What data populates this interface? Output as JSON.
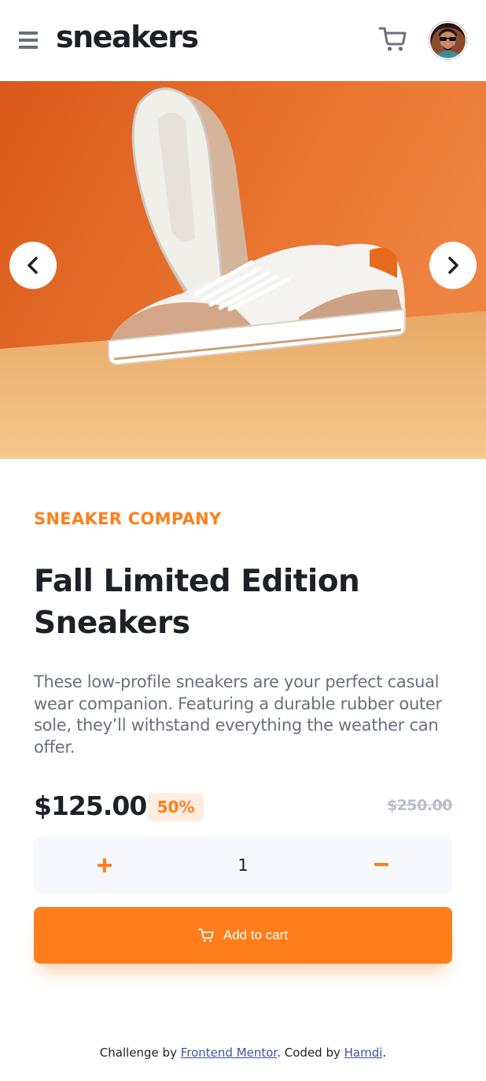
{
  "header": {
    "menu_icon": "hamburger-menu-icon",
    "logo": "sneakers",
    "cart_icon": "cart-icon",
    "avatar_icon": "user-avatar"
  },
  "gallery": {
    "prev_icon": "chevron-left-icon",
    "next_icon": "chevron-right-icon",
    "background_color": "#e8742f",
    "floor_color": "#f0bd7c"
  },
  "product": {
    "company": "SNEAKER COMPANY",
    "title": "Fall Limited Edition Sneakers",
    "description": "These low-profile sneakers are your perfect casual wear companion. Featuring a durable rubber outer sole, they’ll withstand everything the weather can offer.",
    "price": "$125.00",
    "discount": "50%",
    "original_price": "$250.00"
  },
  "quantity": {
    "plus_icon": "plus-icon",
    "minus_icon": "minus-icon",
    "value": "1"
  },
  "cart_button": {
    "icon": "cart-icon",
    "label": "Add to cart"
  },
  "footer": {
    "prefix": "Challenge by ",
    "link1": "Frontend Mentor",
    "middle": ". Coded by ",
    "link2": "Hamdi",
    "suffix": "."
  },
  "colors": {
    "accent": "#ff7e1b",
    "accent_pale": "#ffede0",
    "dark": "#1d2026",
    "gray": "#69707d",
    "light_gray": "#b6bcc8",
    "surface": "#f7f8fd"
  }
}
